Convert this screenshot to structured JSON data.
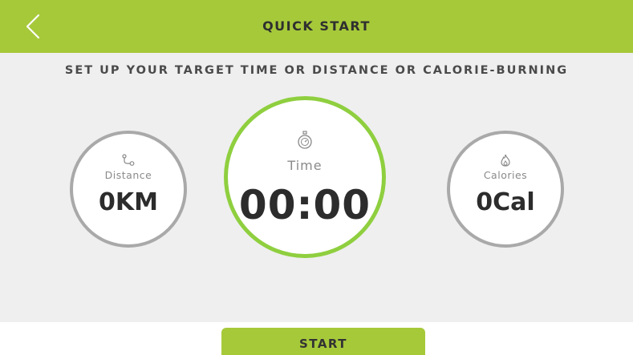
{
  "header": {
    "title": "QUICK START",
    "back_icon": "chevron-left-icon"
  },
  "instructions": "SET UP YOUR TARGET TIME OR DISTANCE OR CALORIE-BURNING",
  "targets": {
    "distance": {
      "label": "Distance",
      "value": "0KM",
      "icon": "distance-icon"
    },
    "time": {
      "label": "Time",
      "value": "00:00",
      "icon": "stopwatch-icon"
    },
    "calories": {
      "label": "Calories",
      "value": "0Cal",
      "icon": "flame-icon"
    }
  },
  "start_button": {
    "label": "START"
  },
  "colors": {
    "accent": "#a6c93a",
    "time_ring": "#8fcf3f",
    "ring_gray": "#a9a9a9",
    "panel_bg": "#efefef"
  }
}
